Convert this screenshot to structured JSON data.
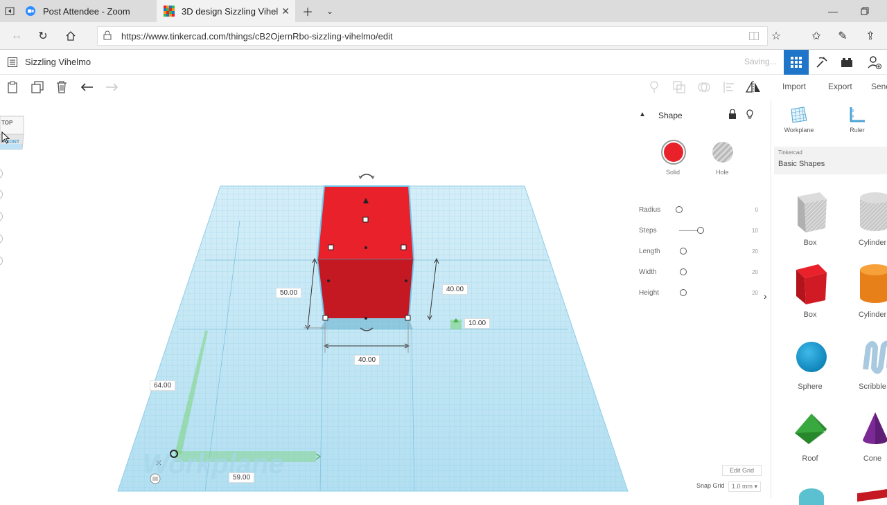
{
  "browser": {
    "tabs": [
      {
        "label": "Post Attendee - Zoom"
      },
      {
        "label": "3D design Sizzling Vihel"
      }
    ],
    "url": "https://www.tinkercad.com/things/cB2OjernRbo-sizzling-vihelmo/edit"
  },
  "app": {
    "design_title": "Sizzling Vihelmo",
    "status": "Saving...",
    "toolbar": {
      "import": "Import",
      "export": "Export",
      "send": "Send"
    }
  },
  "view_cube": {
    "top": "TOP",
    "front": "FRONT"
  },
  "shape_panel": {
    "title": "Shape",
    "solid_label": "Solid",
    "hole_label": "Hole",
    "solid_color": "#e8212b",
    "properties": [
      {
        "label": "Radius",
        "value": "0"
      },
      {
        "label": "Steps",
        "value": "10"
      },
      {
        "label": "Length",
        "value": "20"
      },
      {
        "label": "Width",
        "value": "20"
      },
      {
        "label": "Height",
        "value": "20"
      }
    ]
  },
  "dimensions": {
    "height_left": "50.00",
    "height_right": "40.00",
    "elevation": "10.00",
    "width": "40.00",
    "grid_y": "64.00",
    "grid_x": "59.00"
  },
  "workplane_label": "Workplane",
  "edit_grid": "Edit Grid",
  "snap_grid": {
    "label": "Snap Grid",
    "value": "1.0 mm"
  },
  "shapes_panel": {
    "workplane": "Workplane",
    "ruler": "Ruler",
    "library_source": "Tinkercad",
    "library": "Basic Shapes",
    "items": [
      {
        "label": "Box"
      },
      {
        "label": "Cylinder"
      },
      {
        "label": "Box"
      },
      {
        "label": "Cylinder"
      },
      {
        "label": "Sphere"
      },
      {
        "label": "Scribble"
      },
      {
        "label": "Roof"
      },
      {
        "label": "Cone"
      }
    ]
  },
  "colors": {
    "accent": "#1f75c7",
    "grid": "#b8e1f2",
    "box_red": "#e8212b"
  }
}
